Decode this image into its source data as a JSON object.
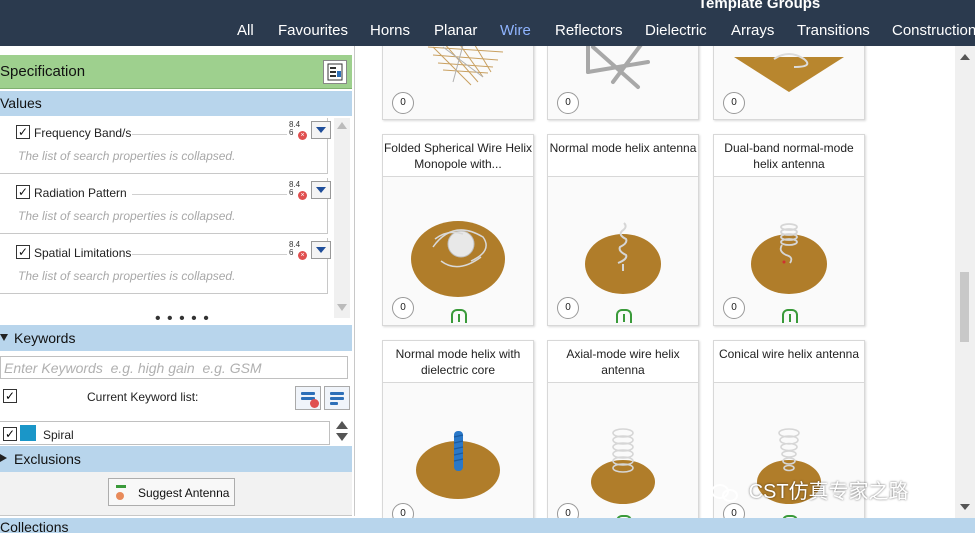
{
  "header": {
    "title": "Template Groups",
    "tabs": [
      {
        "label": "All"
      },
      {
        "label": "Favourites"
      },
      {
        "label": "Horns"
      },
      {
        "label": "Planar"
      },
      {
        "label": "Wire",
        "active": true
      },
      {
        "label": "Reflectors"
      },
      {
        "label": "Dielectric"
      },
      {
        "label": "Arrays"
      },
      {
        "label": "Transitions"
      },
      {
        "label": "Construction"
      }
    ]
  },
  "specification": {
    "title": "Specification",
    "values_title": "Values",
    "criteria": [
      {
        "label": "Frequency Band/s",
        "checked": true,
        "note": "The list of search properties is collapsed.",
        "sort_icon_text": "8.4\n6"
      },
      {
        "label": "Radiation Pattern",
        "checked": true,
        "note": "The list of search properties is collapsed.",
        "sort_icon_text": "8.4\n6"
      },
      {
        "label": "Spatial Limitations",
        "checked": true,
        "note": "The list of search properties is collapsed.",
        "sort_icon_text": "8.4\n6"
      }
    ],
    "splitter": "• • • • •"
  },
  "keywords": {
    "title": "Keywords",
    "placeholder": "Enter Keywords  e.g. high gain  e.g. GSM",
    "current_list_label": "Current Keyword list:",
    "items": [
      {
        "label": "Spiral",
        "checked": true,
        "color": "#1a96c8"
      }
    ]
  },
  "exclusions": {
    "title": "Exclusions",
    "suggest_button": "Suggest Antenna"
  },
  "bottom_bar": {
    "label": "Collections"
  },
  "gallery": {
    "cards": [
      {
        "title": "",
        "count": "0",
        "image": "wire-grid"
      },
      {
        "title": "",
        "count": "0",
        "image": "wire-frame"
      },
      {
        "title": "",
        "count": "0",
        "image": "plate-spiral"
      },
      {
        "title": "Folded Spherical Wire Helix Monopole with...",
        "count": "0",
        "image": "folded-spherical-helix",
        "tag": true
      },
      {
        "title": "Normal mode helix antenna",
        "count": "0",
        "image": "normal-helix",
        "tag": true
      },
      {
        "title": "Dual-band normal-mode helix antenna",
        "count": "0",
        "image": "dual-band-helix",
        "tag": true
      },
      {
        "title": "Normal mode helix with dielectric core",
        "count": "0",
        "image": "helix-dielectric-core"
      },
      {
        "title": "Axial-mode wire helix antenna",
        "count": "0",
        "image": "axial-helix",
        "tag": true
      },
      {
        "title": "Conical wire helix antenna",
        "count": "0",
        "image": "conical-helix",
        "tag": true
      }
    ]
  },
  "watermark": {
    "text": "CST仿真专家之路"
  },
  "colors": {
    "nav_bg": "#2b3a4e",
    "active_tab": "#8fb4ff",
    "spec_header": "#9ed08e",
    "section_header": "#b8d5ec",
    "ground_plane": "#b07d2a"
  }
}
